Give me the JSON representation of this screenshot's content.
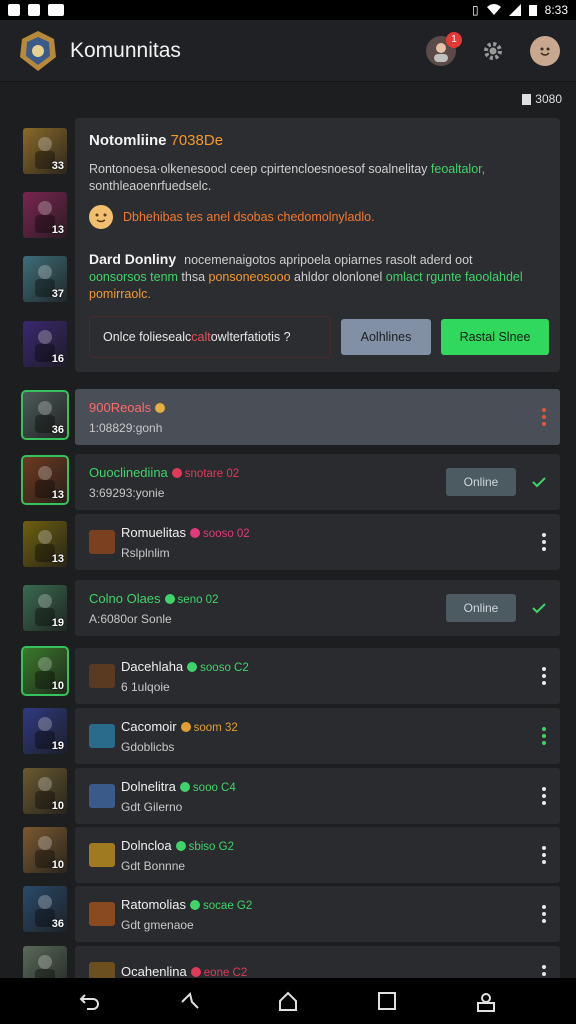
{
  "status_bar": {
    "time": "8:33"
  },
  "app": {
    "title": "Komunnitas",
    "notification_count": "1"
  },
  "count_chip": "3080",
  "feature": {
    "title": "Notomliine",
    "title_accent": "7038De",
    "body_line1": "Rontonoesa·olkenesoocl ceep cpirtencloesnoesof soalnelitay ",
    "body_line1_green": "feoaltalor,",
    "body_line2": "sonthleaoenrfuedselc.",
    "warning": "Dbhehibas tes anel dsobas chedomolnyladlo.",
    "subtitle": "Dard Donliny",
    "subtitle_rest": "nocemenaigotos apripoela opiarnes rasolt aderd oot",
    "body2_green1": "oonsorsos tenm",
    "body2_w1": " thsa ",
    "body2_orange1": "ponsoneosooo",
    "body2_w2": " ahldor olonlonel ",
    "body2_green2": "omlact rgunte faoolahdel",
    "body2_orange2": "pomirraolc.",
    "prompt_text": "Onlce foliesealc",
    "prompt_red": "calt",
    "prompt_text2": " owlterfatiotis ?",
    "btn_grey": "Aolhlines",
    "btn_green": "Rastal Slnee"
  },
  "thumbnails": [
    {
      "num": "33",
      "color": "#8a6a2a"
    },
    {
      "num": "13",
      "color": "#7a2550"
    },
    {
      "num": "37",
      "color": "#3e6e78"
    },
    {
      "num": "16",
      "color": "#3a2870"
    },
    {
      "num": "36",
      "color": "#4c5a58"
    },
    {
      "num": "13",
      "color": "#6e3a20"
    },
    {
      "num": "13",
      "color": "#6e6010"
    },
    {
      "num": "19",
      "color": "#3a6a50"
    },
    {
      "num": "10",
      "color": "#3a7a2a"
    },
    {
      "num": "19",
      "color": "#2e3a80"
    },
    {
      "num": "10",
      "color": "#6a5a30"
    },
    {
      "num": "10",
      "color": "#7a5a30"
    },
    {
      "num": "36",
      "color": "#2a4a6a"
    },
    {
      "num": "",
      "color": "#5a6a5a"
    }
  ],
  "rows": [
    {
      "name": "900Reoals",
      "name_color": "#ff6b6b",
      "tag": "",
      "tag_color": "#e0b040",
      "sub": "1:08829:gonh",
      "right": "dots-red",
      "hl": true
    },
    {
      "name": "Ouoclinediina",
      "name_color": "#3fd46a",
      "tag": "snotare 02",
      "tag_color": "#e03a5a",
      "sub": "3:69293:yonie",
      "right": "online",
      "hl": false
    },
    {
      "name": "Romuelitas",
      "name_color": "#f0f0f0",
      "tag": "sooso 02",
      "tag_color": "#e03a7a",
      "sub": "Rslplnlim",
      "right": "dots",
      "hl": false
    },
    {
      "name": "Colno Olaes",
      "name_color": "#3fd46a",
      "tag": "seno 02",
      "tag_color": "#3fd46a",
      "sub": "A:6080or Sonle",
      "right": "online",
      "hl": false
    },
    {
      "name": "Dacehlaha",
      "name_color": "#f0f0f0",
      "tag": "sooso C2",
      "tag_color": "#3fd46a",
      "sub": "6 1ulqoie",
      "right": "dots",
      "hl": false
    },
    {
      "name": "Cacomoir",
      "name_color": "#f0f0f0",
      "tag": "soom 32",
      "tag_color": "#e0a030",
      "sub": "Gdoblicbs",
      "right": "dots-green",
      "hl": false
    },
    {
      "name": "Dolnelitra",
      "name_color": "#f0f0f0",
      "tag": "sooo C4",
      "tag_color": "#3fd46a",
      "sub": "Gdt Gilerno",
      "right": "dots",
      "hl": false
    },
    {
      "name": "Dolncloa",
      "name_color": "#f0f0f0",
      "tag": "sbiso G2",
      "tag_color": "#3fd46a",
      "sub": "Gdt Bonnne",
      "right": "dots",
      "hl": false
    },
    {
      "name": "Ratomolias",
      "name_color": "#f0f0f0",
      "tag": "socae G2",
      "tag_color": "#3fd46a",
      "sub": "Gdt gmenaoe",
      "right": "dots",
      "hl": false
    },
    {
      "name": "Ocahenlina",
      "name_color": "#f0f0f0",
      "tag": "eone C2",
      "tag_color": "#e03a5a",
      "sub": "",
      "right": "dots",
      "hl": false
    }
  ]
}
